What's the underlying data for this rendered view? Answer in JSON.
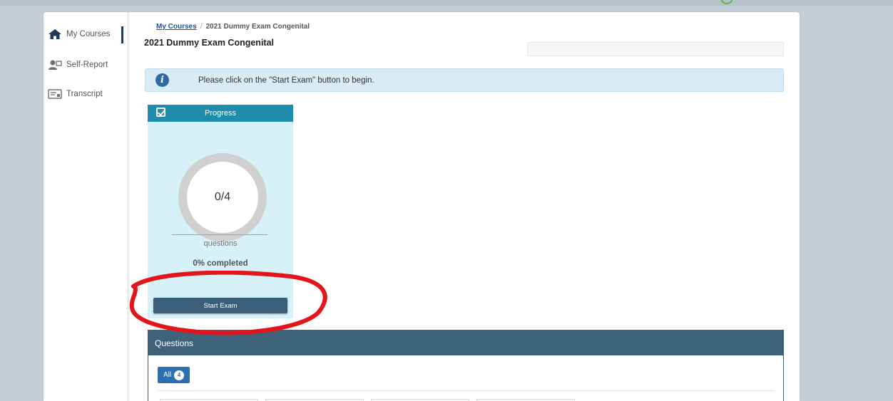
{
  "sidebar": {
    "items": [
      {
        "label": "My Courses",
        "icon": "home-icon"
      },
      {
        "label": "Self-Report",
        "icon": "user-report-icon"
      },
      {
        "label": "Transcript",
        "icon": "transcript-icon"
      }
    ]
  },
  "breadcrumb": {
    "root": "My Courses",
    "separator": "/",
    "current": "2021 Dummy Exam Congenital"
  },
  "page": {
    "title": "2021 Dummy Exam Congenital"
  },
  "alert": {
    "text": "Please click on the \"Start Exam\" button to begin.",
    "icon": "info-icon"
  },
  "progress": {
    "title": "Progress",
    "icon": "checkbox-icon",
    "count": "0/4",
    "unit": "questions",
    "completed": "0% completed",
    "percent_complete": 0,
    "start_label": "Start Exam"
  },
  "questions": {
    "title": "Questions",
    "filter_label": "All",
    "count": "4"
  },
  "colors": {
    "accent": "#1f8cab",
    "button": "#3a5f78",
    "panel_header": "#3d6279",
    "filter_button": "#2b70b3",
    "annotation": "#e3151a"
  }
}
